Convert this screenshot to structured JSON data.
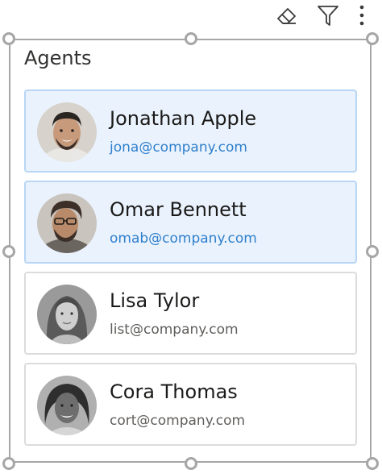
{
  "toolbar": {
    "icons": [
      "eraser-icon",
      "filter-icon",
      "more-vertical-icon"
    ]
  },
  "title": "Agents",
  "agents": [
    {
      "name": "Jonathan Apple",
      "email": "jona@company.com",
      "selected": true
    },
    {
      "name": "Omar Bennett",
      "email": "omab@company.com",
      "selected": true
    },
    {
      "name": "Lisa Tylor",
      "email": "list@company.com",
      "selected": false
    },
    {
      "name": "Cora Thomas",
      "email": "cort@company.com",
      "selected": false
    }
  ],
  "colors": {
    "selected_bg": "#eaf3fd",
    "selected_border": "#b8d6f5",
    "selected_email": "#2f7fcc",
    "frame": "#a6a6a6"
  }
}
